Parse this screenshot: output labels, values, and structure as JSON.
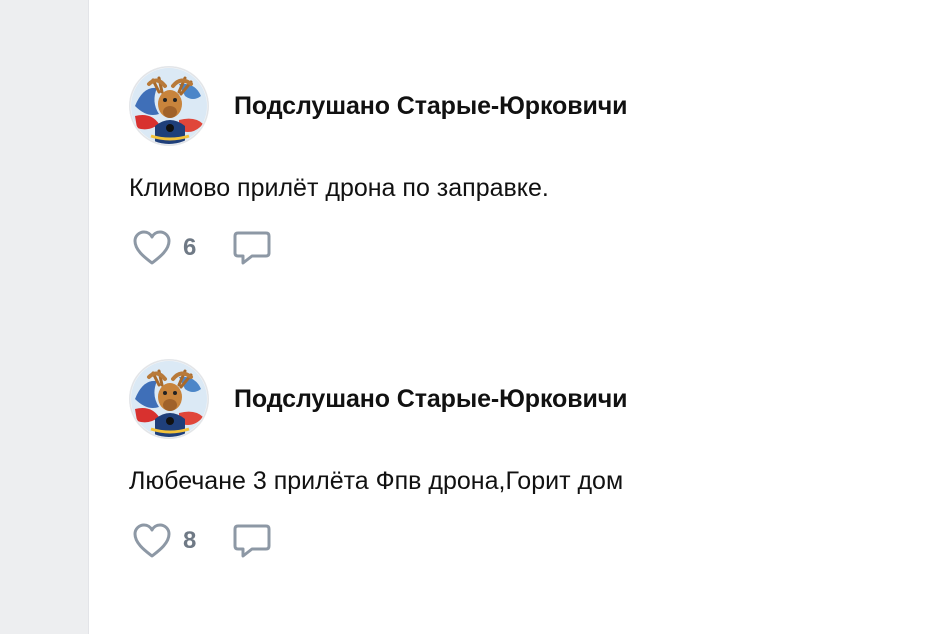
{
  "posts": [
    {
      "author": "Подслушано Старые-Юрковичи",
      "text": "Климово прилёт дрона по заправке.",
      "likes": "6",
      "like_icon": "heart-icon",
      "comment_icon": "comment-icon"
    },
    {
      "author": "Подслушано Старые-Юрковичи",
      "text": "Любечане 3 прилёта Фпв дрона,Горит дом",
      "likes": "8",
      "like_icon": "heart-icon",
      "comment_icon": "comment-icon"
    }
  ],
  "colors": {
    "background": "#ffffff",
    "rail": "#edeef0",
    "text": "#111111",
    "icon": "#8d98a5",
    "count": "#6f7985"
  }
}
